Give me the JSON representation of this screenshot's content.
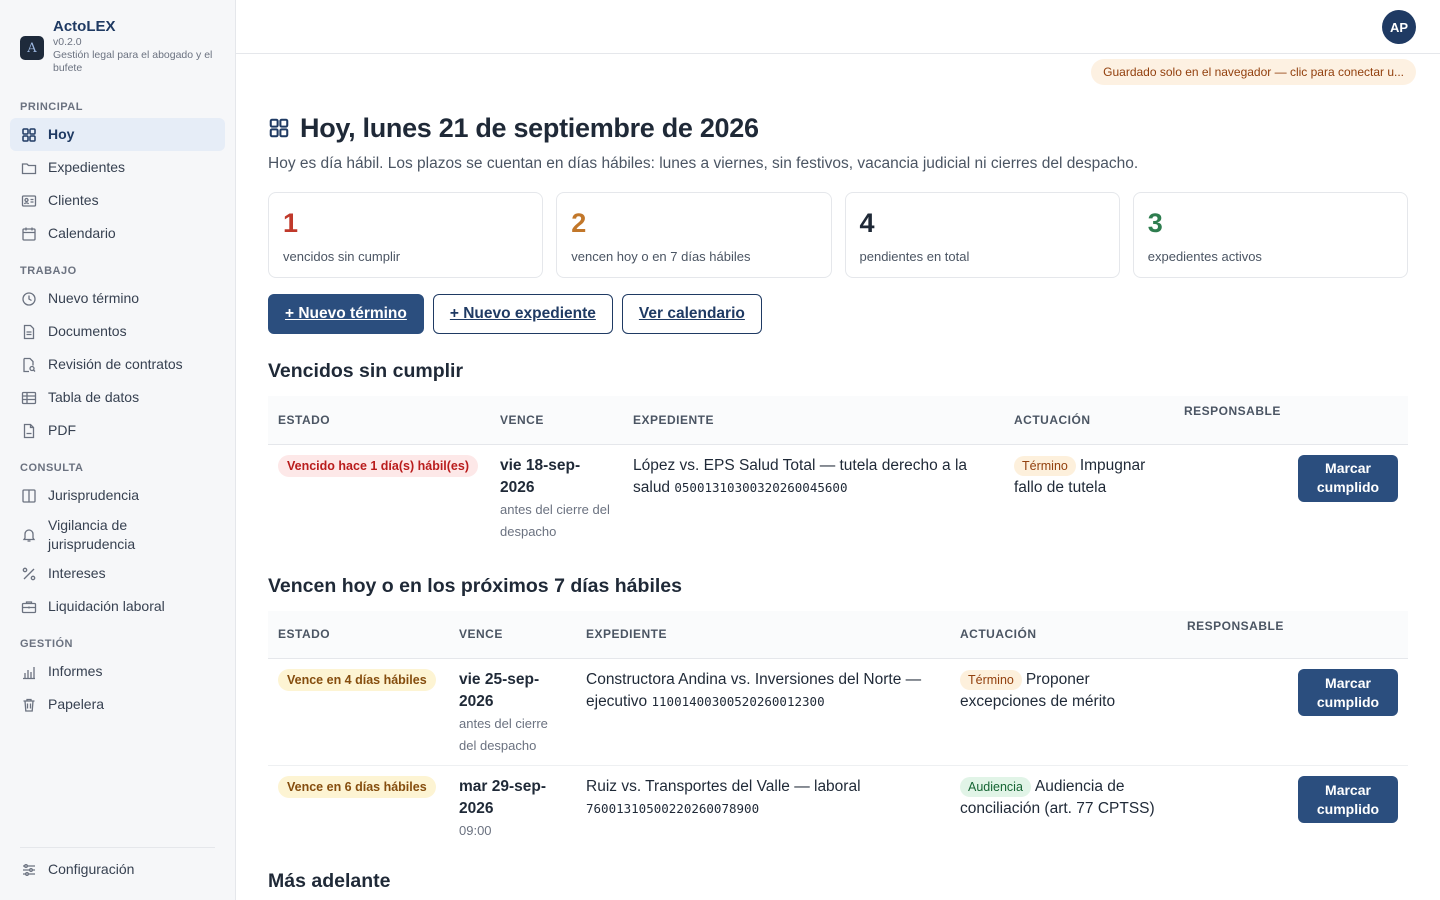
{
  "app": {
    "name": "ActoLEX",
    "version": "v0.2.0",
    "tagline": "Gestión legal para el abogado y el bufete",
    "user_initials": "AP",
    "save_banner": "Guardado solo en el navegador — clic para conectar u..."
  },
  "sidebar": {
    "sections": [
      {
        "title": "PRINCIPAL",
        "items": [
          {
            "label": "Hoy",
            "icon": "grid-icon",
            "active": true
          },
          {
            "label": "Expedientes",
            "icon": "folder-icon"
          },
          {
            "label": "Clientes",
            "icon": "id-card-icon"
          },
          {
            "label": "Calendario",
            "icon": "calendar-icon"
          }
        ]
      },
      {
        "title": "TRABAJO",
        "items": [
          {
            "label": "Nuevo término",
            "icon": "clock-icon"
          },
          {
            "label": "Documentos",
            "icon": "document-icon"
          },
          {
            "label": "Revisión de contratos",
            "icon": "document-search-icon"
          },
          {
            "label": "Tabla de datos",
            "icon": "table-icon"
          },
          {
            "label": "PDF",
            "icon": "pdf-icon"
          }
        ]
      },
      {
        "title": "CONSULTA",
        "items": [
          {
            "label": "Jurisprudencia",
            "icon": "book-icon"
          },
          {
            "label": "Vigilancia de jurisprudencia",
            "icon": "bell-icon"
          },
          {
            "label": "Intereses",
            "icon": "percent-icon"
          },
          {
            "label": "Liquidación laboral",
            "icon": "briefcase-icon"
          }
        ]
      },
      {
        "title": "GESTIÓN",
        "items": [
          {
            "label": "Informes",
            "icon": "bar-chart-icon"
          },
          {
            "label": "Papelera",
            "icon": "trash-icon"
          }
        ]
      }
    ],
    "settings_label": "Configuración"
  },
  "main": {
    "title": "Hoy, lunes 21 de septiembre de 2026",
    "subtitle": "Hoy es día hábil. Los plazos se cuentan en días hábiles: lunes a viernes, sin festivos, vacancia judicial ni cierres del despacho.",
    "stats": [
      {
        "value": "1",
        "label": "vencidos sin cumplir",
        "color": "#c0392b"
      },
      {
        "value": "2",
        "label": "vencen hoy o en 7 días hábiles",
        "color": "#c2772a"
      },
      {
        "value": "4",
        "label": "pendientes en total",
        "color": "#1f2937"
      },
      {
        "value": "3",
        "label": "expedientes activos",
        "color": "#2e7d4f"
      }
    ],
    "actions": {
      "new_term": "+ Nuevo término",
      "new_case": "+ Nuevo expediente",
      "calendar": "Ver calendario"
    },
    "columns": {
      "estado": "ESTADO",
      "vence": "VENCE",
      "expediente": "EXPEDIENTE",
      "actuacion": "ACTUACIÓN",
      "responsable": "RESPONSABLE"
    },
    "overdue": {
      "title": "Vencidos sin cumplir",
      "rows": [
        {
          "estado": "Vencido hace 1 día(s) hábil(es)",
          "vence_date": "vie 18-sep-2026",
          "vence_note": "antes del cierre del despacho",
          "expediente": "López vs. EPS Salud Total — tutela derecho a la salud",
          "radicado": "05001310300320260045600",
          "tag": "Término",
          "actuacion": "Impugnar fallo de tutela",
          "responsable": "",
          "button": "Marcar cumplido"
        }
      ]
    },
    "upcoming": {
      "title": "Vencen hoy o en los próximos 7 días hábiles",
      "rows": [
        {
          "estado": "Vence en 4 días hábiles",
          "vence_date": "vie 25-sep-2026",
          "vence_note": "antes del cierre del despacho",
          "expediente": "Constructora Andina vs. Inversiones del Norte — ejecutivo",
          "radicado": "11001400300520260012300",
          "tag": "Término",
          "actuacion": "Proponer excepciones de mérito",
          "responsable": "",
          "button": "Marcar cumplido"
        },
        {
          "estado": "Vence en 6 días hábiles",
          "vence_date": "mar 29-sep-2026",
          "vence_note": "09:00",
          "expediente": "Ruiz vs. Transportes del Valle — laboral",
          "radicado": "76001310500220260078900",
          "tag": "Audiencia",
          "actuacion": "Audiencia de conciliación (art. 77 CPTSS)",
          "responsable": "",
          "button": "Marcar cumplido"
        }
      ]
    },
    "later_title": "Más adelante"
  }
}
